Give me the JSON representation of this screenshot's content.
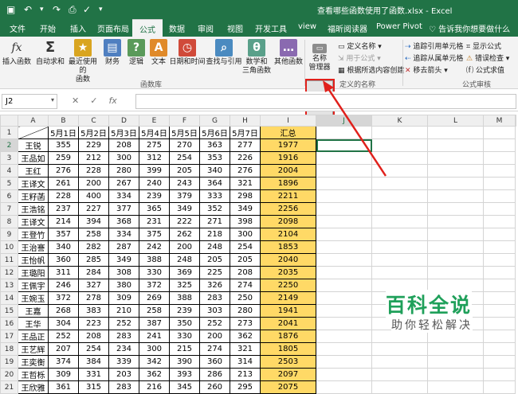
{
  "window": {
    "title": "查看哪些函数使用了函数.xlsx - Excel"
  },
  "tabs": [
    "文件",
    "开始",
    "插入",
    "页面布局",
    "公式",
    "数据",
    "审阅",
    "视图",
    "开发工具",
    "view",
    "福昕阅读器",
    "Power Pivot"
  ],
  "active_tab": "公式",
  "tell_me": "告诉我你想要做什么",
  "ribbon": {
    "buttons": [
      {
        "label": "插入函数",
        "icon": "fx"
      },
      {
        "label": "自动求和",
        "icon": "Σ"
      },
      {
        "label": "最近使用的\n函数",
        "icon": "★"
      },
      {
        "label": "财务",
        "icon": "▤"
      },
      {
        "label": "逻辑",
        "icon": "?"
      },
      {
        "label": "文本",
        "icon": "A"
      },
      {
        "label": "日期和时间",
        "icon": "◷"
      },
      {
        "label": "查找与引用",
        "icon": "⌕"
      },
      {
        "label": "数学和\n三角函数",
        "icon": "θ"
      },
      {
        "label": "其他函数",
        "icon": "…"
      },
      {
        "label": "名称\n管理器",
        "icon": "▭"
      }
    ],
    "group_library": "函数库",
    "group_names": "定义的名称",
    "group_audit": "公式审核",
    "defined_names": [
      "定义名称 ▾",
      "用于公式 ▾",
      "根据所选内容创建"
    ],
    "audit": [
      "追踪引用单元格",
      "追踪从属单元格",
      "移去箭头 ▾",
      "显示公式",
      "错误检查 ▾",
      "公式求值"
    ]
  },
  "formula_bar": {
    "name_box": "J2",
    "fx": "fx"
  },
  "sheet": {
    "columns": [
      "A",
      "B",
      "C",
      "D",
      "E",
      "F",
      "G",
      "H",
      "I",
      "J",
      "K",
      "L",
      "M"
    ],
    "header_row": [
      "",
      "5月1日",
      "5月2日",
      "5月3日",
      "5月4日",
      "5月5日",
      "5月6日",
      "5月7日",
      "汇总"
    ],
    "rows": [
      [
        "王锐",
        "355",
        "229",
        "208",
        "275",
        "270",
        "363",
        "277",
        "1977"
      ],
      [
        "王品如",
        "259",
        "212",
        "300",
        "312",
        "254",
        "353",
        "226",
        "1916"
      ],
      [
        "王红",
        "276",
        "228",
        "280",
        "399",
        "205",
        "340",
        "276",
        "2004"
      ],
      [
        "王译文",
        "261",
        "200",
        "267",
        "240",
        "243",
        "364",
        "321",
        "1896"
      ],
      [
        "王籽菡",
        "228",
        "400",
        "334",
        "239",
        "379",
        "333",
        "298",
        "2211"
      ],
      [
        "王浩铭",
        "237",
        "227",
        "377",
        "365",
        "349",
        "352",
        "349",
        "2256"
      ],
      [
        "王译文",
        "214",
        "394",
        "368",
        "231",
        "222",
        "271",
        "398",
        "2098"
      ],
      [
        "王登竹",
        "357",
        "258",
        "334",
        "375",
        "262",
        "218",
        "300",
        "2104"
      ],
      [
        "王治謇",
        "340",
        "282",
        "287",
        "242",
        "200",
        "248",
        "254",
        "1853"
      ],
      [
        "王怡帆",
        "360",
        "285",
        "349",
        "388",
        "248",
        "205",
        "205",
        "2040"
      ],
      [
        "王璐阳",
        "311",
        "284",
        "308",
        "330",
        "369",
        "225",
        "208",
        "2035"
      ],
      [
        "王佩宇",
        "246",
        "327",
        "380",
        "372",
        "325",
        "326",
        "274",
        "2250"
      ],
      [
        "王婉玉",
        "372",
        "278",
        "309",
        "269",
        "388",
        "283",
        "250",
        "2149"
      ],
      [
        "王嘉",
        "268",
        "383",
        "210",
        "258",
        "239",
        "303",
        "280",
        "1941"
      ],
      [
        "王华",
        "304",
        "223",
        "252",
        "387",
        "350",
        "252",
        "273",
        "2041"
      ],
      [
        "王品正",
        "252",
        "208",
        "283",
        "241",
        "330",
        "200",
        "362",
        "1876"
      ],
      [
        "王艺辉",
        "207",
        "254",
        "234",
        "300",
        "215",
        "274",
        "321",
        "1805"
      ],
      [
        "王奕衡",
        "374",
        "384",
        "339",
        "342",
        "390",
        "360",
        "314",
        "2503"
      ],
      [
        "王哲栎",
        "309",
        "331",
        "203",
        "362",
        "393",
        "286",
        "213",
        "2097"
      ],
      [
        "王欣雅",
        "361",
        "315",
        "283",
        "216",
        "345",
        "260",
        "295",
        "2075"
      ]
    ]
  },
  "watermark": {
    "title": "百科全说",
    "subtitle": "助你轻松解决"
  },
  "colors": {
    "excel_green": "#217346",
    "highlight": "#ffd966",
    "callout_red": "#e0201b"
  }
}
